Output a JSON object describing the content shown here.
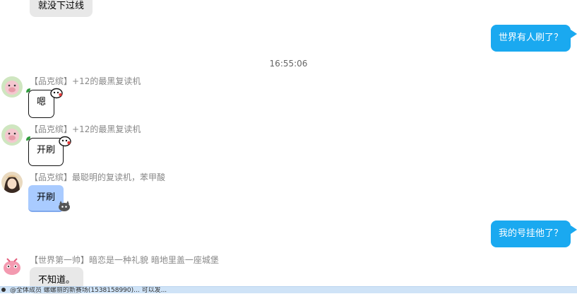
{
  "messages": [
    {
      "id": "m0",
      "text": "就没下过线"
    },
    {
      "id": "m1",
      "text": "世界有人刷了？"
    },
    {
      "id": "m5",
      "text": "我的号挂他了？"
    }
  ],
  "timestamp": "16:55:06",
  "groups": [
    {
      "name": "【品克缤】",
      "title": "+12的最黑复读机",
      "text": "嗯"
    },
    {
      "name": "【品克缤】",
      "title": "+12的最黑复读机",
      "text": "开刷"
    },
    {
      "name": "【品克缤】",
      "title": "最聪明的复读机，苯甲酸",
      "text": "开刷"
    },
    {
      "name": "【世界第一帅】",
      "title": "暗恋是一种礼貌 暗地里盖一座城堡",
      "text": "不知道。"
    }
  ],
  "bottom_bar": {
    "text": "@全体成员 螺螺丽的新赛场(1538158990)... 可以发..."
  },
  "colors": {
    "self_bubble": "#1aa9f0",
    "other_bubble": "#e8e8e8",
    "pastel_bubble": "#a9cbff"
  },
  "icons": [
    "cat-sticker-icon",
    "bubble-bear-icon"
  ]
}
